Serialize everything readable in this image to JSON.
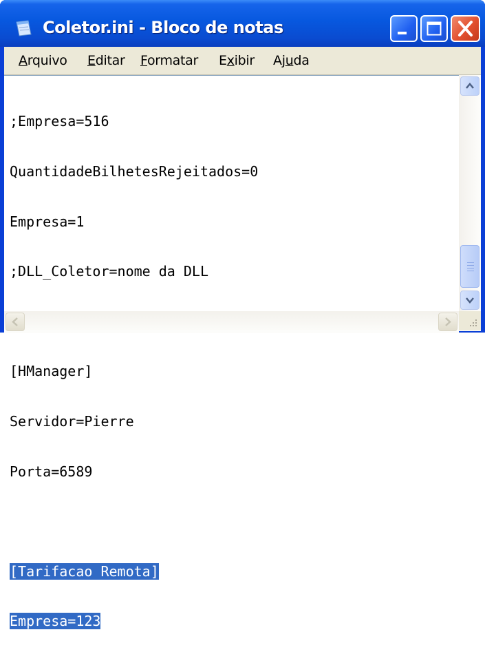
{
  "window": {
    "title": "Coletor.ini - Bloco de notas",
    "icon": "notepad-icon",
    "controls": [
      "minimize-icon",
      "maximize-icon",
      "close-icon"
    ]
  },
  "menu": {
    "items": [
      {
        "label": "Arquivo",
        "mnemonic": "A"
      },
      {
        "label": "Editar",
        "mnemonic": "E"
      },
      {
        "label": "Formatar",
        "mnemonic": "F"
      },
      {
        "label": "Exibir",
        "mnemonic": "x"
      },
      {
        "label": "Ajuda",
        "mnemonic": "u"
      }
    ]
  },
  "editor": {
    "lines": [
      ";Empresa=516",
      "QuantidadeBilhetesRejeitados=0",
      "Empresa=1",
      ";DLL_Coletor=nome da DLL",
      "",
      "[HManager]",
      "Servidor=Pierre",
      "Porta=6589",
      "",
      "[Tarifacao Remota]",
      "Empresa=123"
    ],
    "selected_lines": [
      "[Tarifacao Remota]",
      "Empresa=123"
    ]
  },
  "colors": {
    "title_bar": "#0758df",
    "selection": "#316ac5",
    "close_button": "#e2502e"
  }
}
